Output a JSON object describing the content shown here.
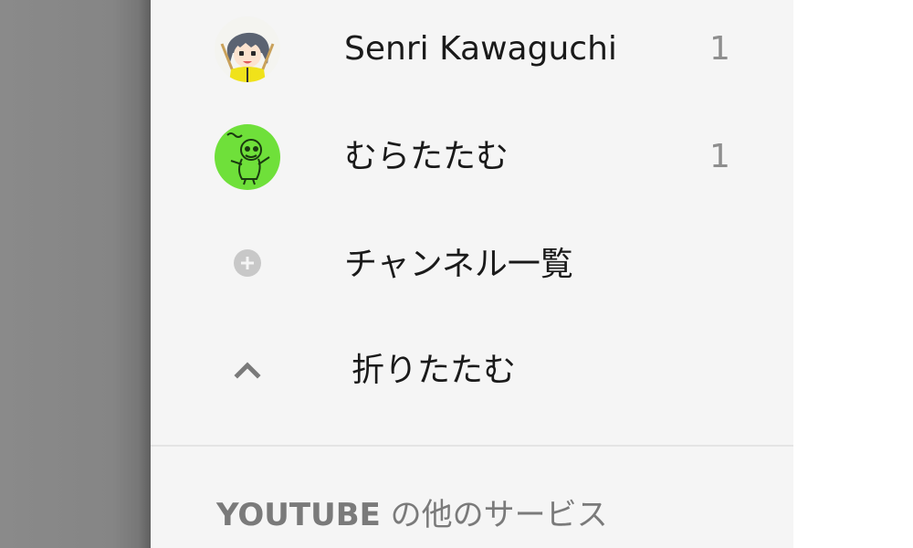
{
  "subscriptions": [
    {
      "name": "Senri Kawaguchi",
      "count": "1",
      "avatar": "avatar-anime-girl"
    },
    {
      "name": "むらたたむ",
      "count": "1",
      "avatar": "avatar-green-doodle"
    }
  ],
  "channel_list": {
    "label": "チャンネル一覧",
    "icon": "plus-circle-icon"
  },
  "collapse": {
    "label": "折りたたむ",
    "icon": "chevron-up-icon"
  },
  "section": {
    "brand": "YOUTUBE",
    "rest": " の他のサービス"
  },
  "colors": {
    "sidebar_bg": "#f5f5f5",
    "text": "#1a1a1a",
    "count": "#8e8e8e",
    "section_title": "#7a7a7a",
    "icon_gray": "#c8c8c8"
  }
}
